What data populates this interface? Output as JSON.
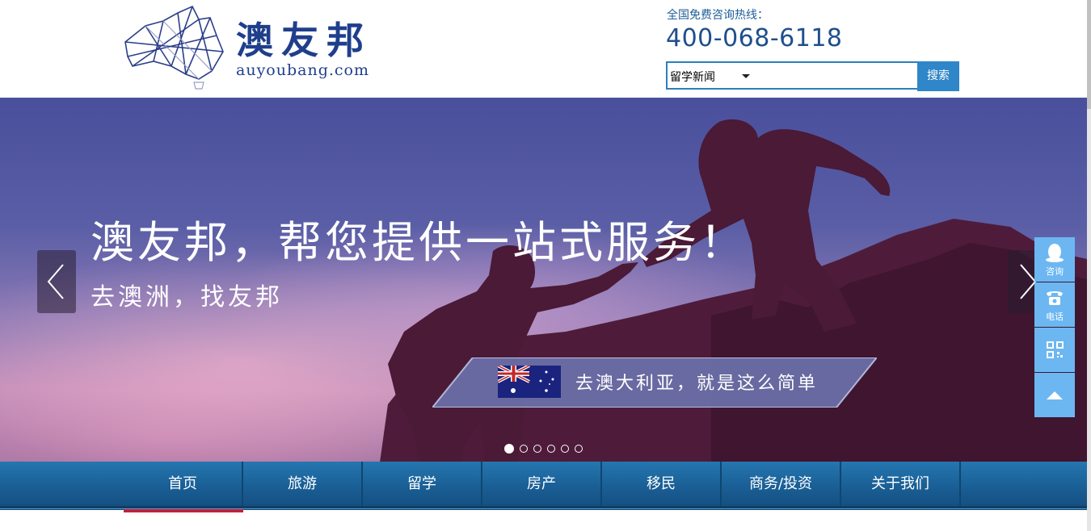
{
  "header": {
    "logo_cn": "澳友邦",
    "logo_en": "auyoubang.com",
    "hotline_label": "全国免费咨询热线：",
    "hotline_number": "400-068-6118",
    "search": {
      "category": "留学新闻",
      "placeholder": "",
      "button": "搜索"
    }
  },
  "banner": {
    "slogan_main": "澳友邦，帮您提供一站式服务！",
    "slogan_sub": "去澳洲，找友邦",
    "ribbon_text": "去澳大利亚，就是这么简单",
    "slide_count": 6,
    "active_slide": 1
  },
  "nav": {
    "items": [
      {
        "label": "首页",
        "active": true
      },
      {
        "label": "旅游"
      },
      {
        "label": "留学"
      },
      {
        "label": "房产"
      },
      {
        "label": "移民"
      },
      {
        "label": "商务/投资"
      },
      {
        "label": "关于我们"
      }
    ]
  },
  "side": {
    "consult": "咨询",
    "phone": "电话"
  },
  "colors": {
    "brand": "#1f3f8c",
    "nav": "#1a5f96",
    "nav_active": "#c0203c",
    "side": "#6cb7f2",
    "search_button": "#2f86c8"
  }
}
